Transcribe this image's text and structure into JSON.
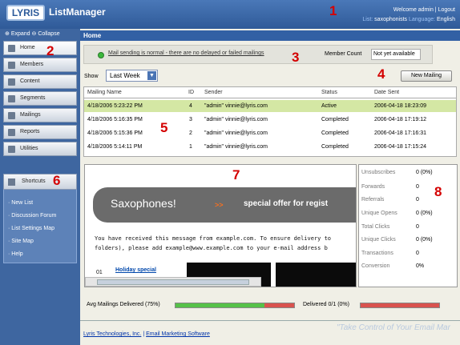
{
  "app": {
    "logo": "LYRIS",
    "title": "ListManager"
  },
  "header": {
    "welcome": "Welcome admin",
    "sep": " | ",
    "logout": "Logout",
    "list_label": "List:",
    "list_value": "saxophonists",
    "lang_label": "Language:",
    "lang_value": "English"
  },
  "sidebar": {
    "expand": "Expand",
    "collapse": "Collapse",
    "items": [
      {
        "label": "Home",
        "icon": "home-icon"
      },
      {
        "label": "Members",
        "icon": "members-icon"
      },
      {
        "label": "Content",
        "icon": "content-icon"
      },
      {
        "label": "Segments",
        "icon": "segments-icon"
      },
      {
        "label": "Mailings",
        "icon": "mailings-icon"
      },
      {
        "label": "Reports",
        "icon": "reports-icon"
      },
      {
        "label": "Utilities",
        "icon": "utilities-icon"
      }
    ]
  },
  "shortcuts": {
    "title": "Shortcuts",
    "items": [
      "New List",
      "Discussion Forum",
      "List Settings Map",
      "Site Map",
      "Help"
    ]
  },
  "main": {
    "tab": "Home",
    "status_msg": "Mail sending is normal - there are no delayed or failed mailings",
    "member_count_label": "Member Count",
    "member_count_value": "Not yet available",
    "show_label": "Show",
    "show_value": "Last Week",
    "new_mailing": "New Mailing"
  },
  "table": {
    "headers": [
      "Mailing Name",
      "ID",
      "Sender",
      "Status",
      "Date Sent"
    ],
    "rows": [
      [
        "4/18/2006 5:23:22 PM",
        "4",
        "\"admin\" vinnie@lyris.com",
        "Active",
        "2006-04-18 18:23:09"
      ],
      [
        "4/18/2006 5:16:35 PM",
        "3",
        "\"admin\" vinnie@lyris.com",
        "Completed",
        "2006-04-18 17:19:12"
      ],
      [
        "4/18/2006 5:15:36 PM",
        "2",
        "\"admin\" vinnie@lyris.com",
        "Completed",
        "2006-04-18 17:16:31"
      ],
      [
        "4/18/2006 5:14:11 PM",
        "1",
        "\"admin\" vinnie@lyris.com",
        "Completed",
        "2006-04-18 17:15:24"
      ]
    ]
  },
  "preview": {
    "banner_title": "Saxophones!",
    "banner_arrows": ">>",
    "banner_offer": "special offer for regist",
    "line1": "You have received this message from example.com. To ensure delivery to",
    "line2": "folders), please add example@www.example.com to your e-mail address b",
    "item_num": "01",
    "holiday": "Holiday special"
  },
  "stats": [
    {
      "label": "Unsubscribes",
      "value": "0 (0%)"
    },
    {
      "label": "Forwards",
      "value": "0"
    },
    {
      "label": "Referrals",
      "value": "0"
    },
    {
      "label": "Unique Opens",
      "value": "0 (0%)"
    },
    {
      "label": "Total Clicks",
      "value": "0"
    },
    {
      "label": "Unique Clicks",
      "value": "0 (0%)"
    },
    {
      "label": "Transactions",
      "value": "0"
    },
    {
      "label": "Conversion",
      "value": "0%"
    }
  ],
  "progress": {
    "avg_label": "Avg Mailings Delivered (75%)",
    "avg_fraction": 0.75,
    "delivered_label": "Delivered 0/1 (0%)",
    "delivered_fraction": 0.0
  },
  "footer": {
    "company": "Lyris Technologies, Inc.",
    "sep": " | ",
    "software": "Email Marketing Software",
    "tagline": "\"Take Control of Your Email Mar"
  },
  "annotations": [
    "1",
    "2",
    "3",
    "4",
    "5",
    "6",
    "7",
    "8"
  ],
  "colors": {
    "header": "#2f5a98",
    "highlight": "#d4e7a4",
    "success": "#3cb83c",
    "fail": "#d9534f",
    "accent": "#d40000"
  }
}
